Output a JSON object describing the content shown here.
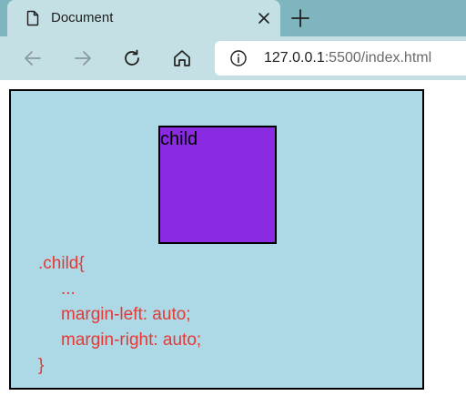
{
  "tab": {
    "title": "Document",
    "icon": "document-icon"
  },
  "toolbar": {
    "back_icon": "back-arrow-icon",
    "forward_icon": "forward-arrow-icon",
    "reload_icon": "reload-icon",
    "home_icon": "home-icon",
    "url_host": "127.0.0.1",
    "url_rest": ":5500/index.html"
  },
  "page": {
    "child_label": "child",
    "parent_color": "#add8e6",
    "child_color": "#8a2be2",
    "code_color": "#e53935",
    "code_lines": [
      ".child{",
      "...",
      "margin-left: auto;",
      "margin-right: auto;",
      "}"
    ]
  }
}
